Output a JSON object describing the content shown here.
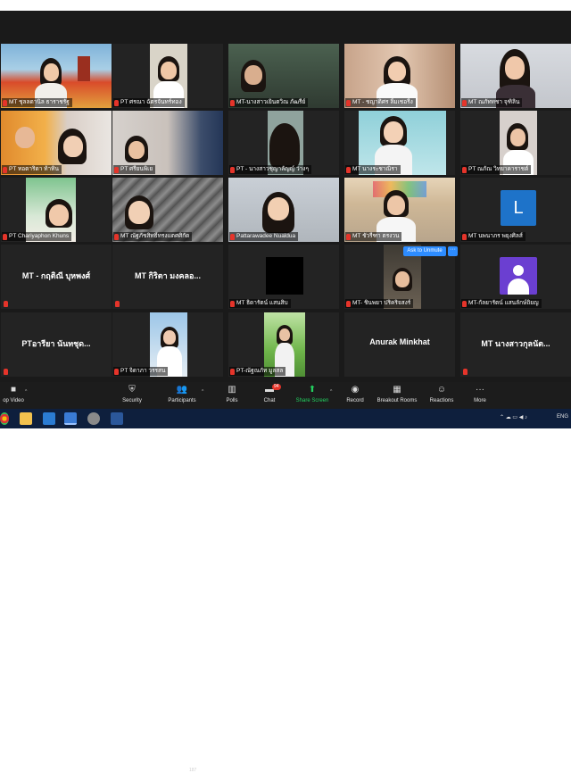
{
  "gallery": {
    "tiles": [
      {
        "name": "MT ชุลลดานิล ธาราชรัฐ",
        "muted": true
      },
      {
        "name": "PT ศรณา ฉัตรจันทร์ทอง",
        "muted": true
      },
      {
        "name": "MT-นางสาวเยินตวิณ ภัฒรีย์",
        "muted": true
      },
      {
        "name": "MT - ชญาดิศร ลิ้มเชอรืง",
        "muted": true
      },
      {
        "name": "MT ณภัททชา จุฑิลิน",
        "muted": true
      },
      {
        "name": "PT ทอตาริดา ท้าทิน",
        "muted": true
      },
      {
        "name": "PT ศรียนพิเย",
        "muted": true
      },
      {
        "name": "",
        "muted": false
      },
      {
        "name": "PT - นางสาวชุญาลัญญ์ ว่างๆ",
        "muted": true
      },
      {
        "name": "MT นางระชาณิรา",
        "muted": true
      },
      {
        "name": "PT ณภัณ วิทยาคาราชต์",
        "muted": true
      },
      {
        "name": "PT Chariyaphon Khuns",
        "muted": true
      },
      {
        "name": "MT ณัฐภัชสิทธิ์ทรงแตศศิกัด",
        "muted": true
      },
      {
        "name": "Pattarawadee Nualdua",
        "muted": true
      },
      {
        "name": "MT ชัวรีฑา ตรงวน",
        "muted": true
      },
      {
        "name": "MT นพนาภร พยุงศิลส์",
        "muted": true
      },
      {
        "name": "MT ธิดารัตน์ แสนสิบ",
        "muted": true
      },
      {
        "name": "MT- ชินพยา ปริคริจสงร์",
        "muted": true
      },
      {
        "name": "MT-กัลยารัตน์ แสนลักษ์ถิยญ",
        "muted": true
      },
      {
        "name": "PT จิดาภา วรรสน",
        "muted": true
      },
      {
        "name": "PT-ณัฐณภัท มูลสล",
        "muted": true
      }
    ],
    "big_names": [
      "MT - กฤติณี บุหพงศ์",
      "MT กิริตา มงคลอ...",
      "PTอารียา นันทชุด...",
      "Anurak Minkhat",
      "MT นางสาวกุลนัต..."
    ],
    "avatar_letter": "L",
    "unmute_label": "Ask to Unmute",
    "more_label": "···"
  },
  "toolbar": {
    "stop_video": "op Video",
    "security": "Security",
    "participants": "Participants",
    "participants_count": "187",
    "polls": "Polls",
    "chat": "Chat",
    "chat_badge": "94",
    "share_screen": "Share Screen",
    "record": "Record",
    "breakout_rooms": "Breakout Rooms",
    "reactions": "Reactions",
    "more": "More"
  },
  "taskbar": {
    "language": "ENG"
  },
  "colors": {
    "zoom_blue": "#2d8cff",
    "muted_red": "#e5342a",
    "share_green": "#23d160",
    "tile_bg": "#232323"
  }
}
